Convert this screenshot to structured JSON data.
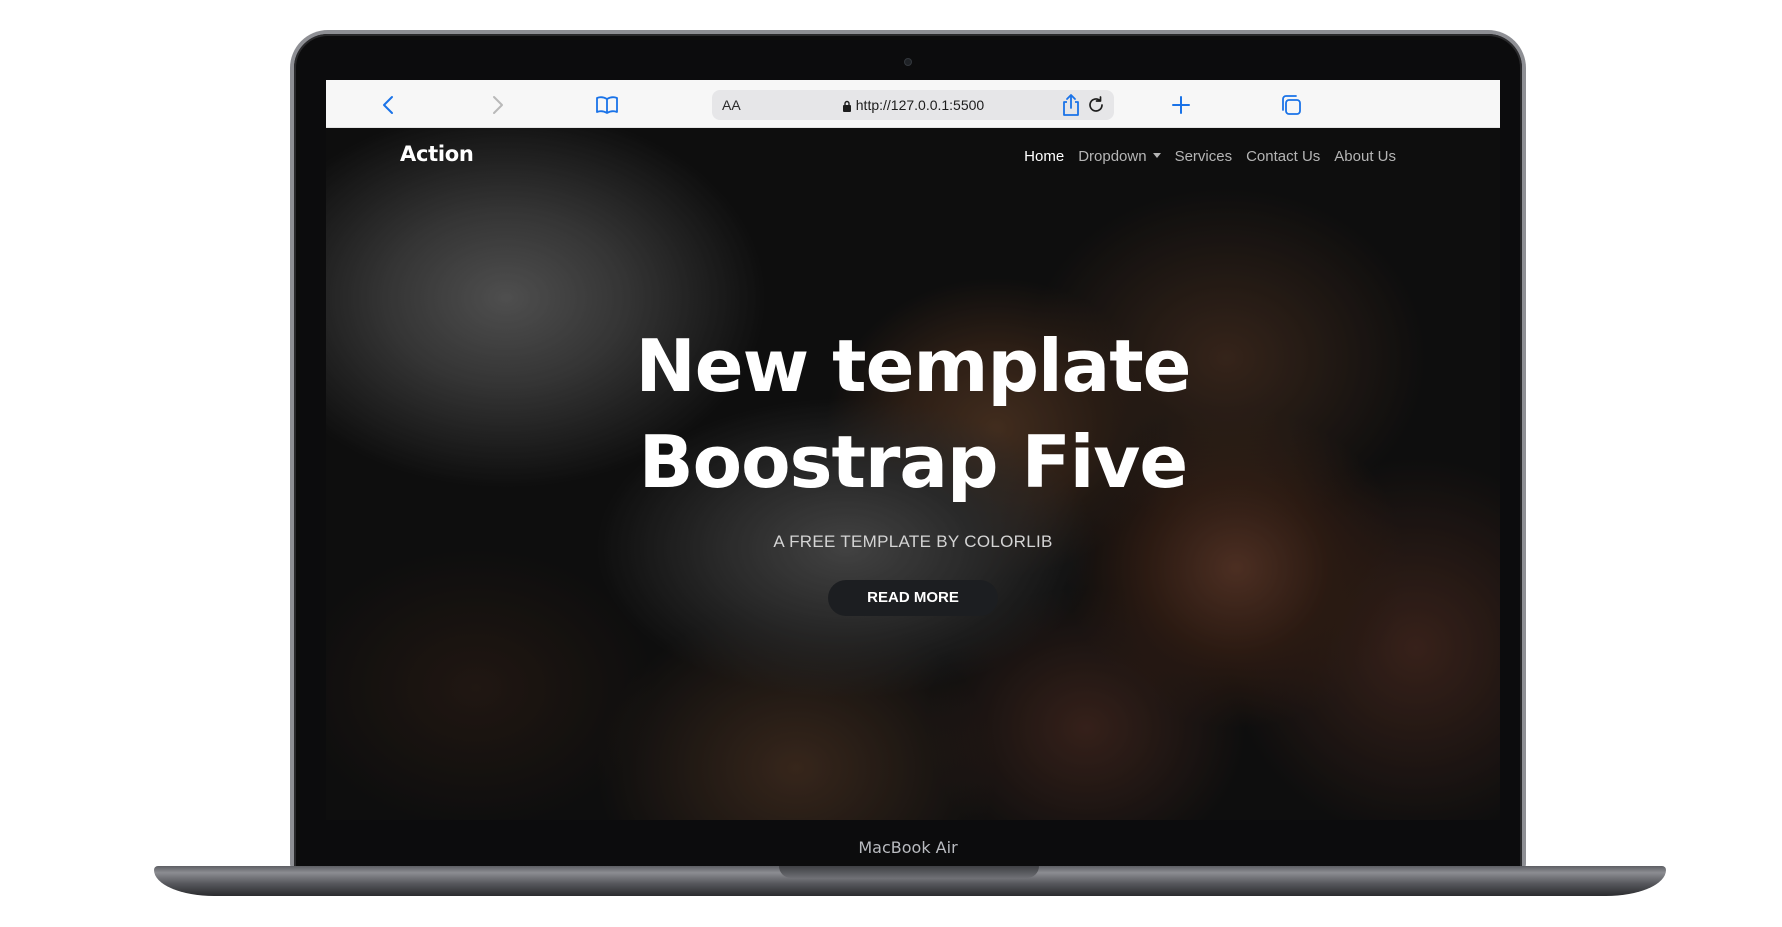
{
  "device": {
    "label": "MacBook Air"
  },
  "browser": {
    "text_size_label": "AA",
    "url": "http://127.0.0.1:5500",
    "icons": {
      "back": "chevron-left-icon",
      "forward": "chevron-right-icon",
      "bookmarks": "book-icon",
      "lock": "lock-icon",
      "reload": "reload-icon",
      "share": "share-icon",
      "new_tab": "plus-icon",
      "tabs": "tabs-icon"
    },
    "accent_color": "#1a73e8"
  },
  "site": {
    "brand": "Action",
    "nav": {
      "home": "Home",
      "dropdown": "Dropdown",
      "services": "Services",
      "contact": "Contact Us",
      "about": "About Us"
    },
    "hero": {
      "title_line1": "New template",
      "title_line2": "Boostrap Five",
      "subtitle": "A FREE TEMPLATE BY COLORLIB",
      "button": "READ MORE"
    }
  }
}
